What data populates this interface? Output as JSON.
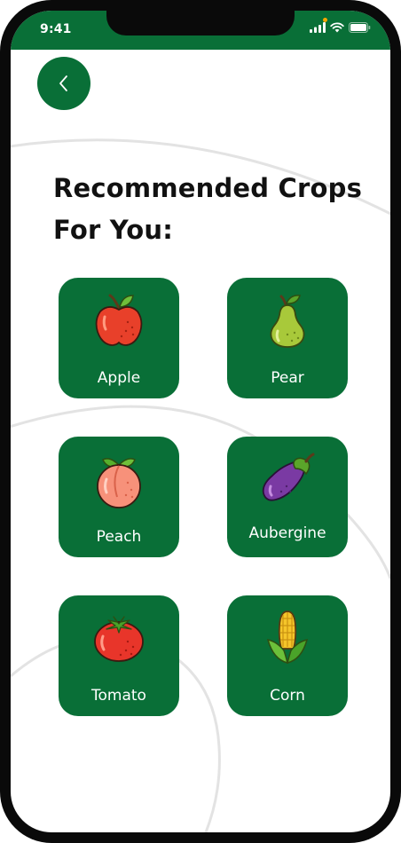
{
  "status_bar": {
    "time": "9:41",
    "icons": [
      "signal-icon",
      "wifi-icon",
      "battery-icon"
    ]
  },
  "back_button": {
    "icon": "chevron-left-icon"
  },
  "title": "Recommended Crops For You:",
  "colors": {
    "brand_green": "#096f37",
    "title_text": "#111111",
    "card_text": "#ffffff",
    "arc_lines": "#e3e3e3"
  },
  "crops": [
    {
      "name": "Apple",
      "icon": "apple-icon"
    },
    {
      "name": "Pear",
      "icon": "pear-icon"
    },
    {
      "name": "Peach",
      "icon": "peach-icon"
    },
    {
      "name": "Aubergine",
      "icon": "aubergine-icon"
    },
    {
      "name": "Tomato",
      "icon": "tomato-icon"
    },
    {
      "name": "Corn",
      "icon": "corn-icon"
    }
  ]
}
